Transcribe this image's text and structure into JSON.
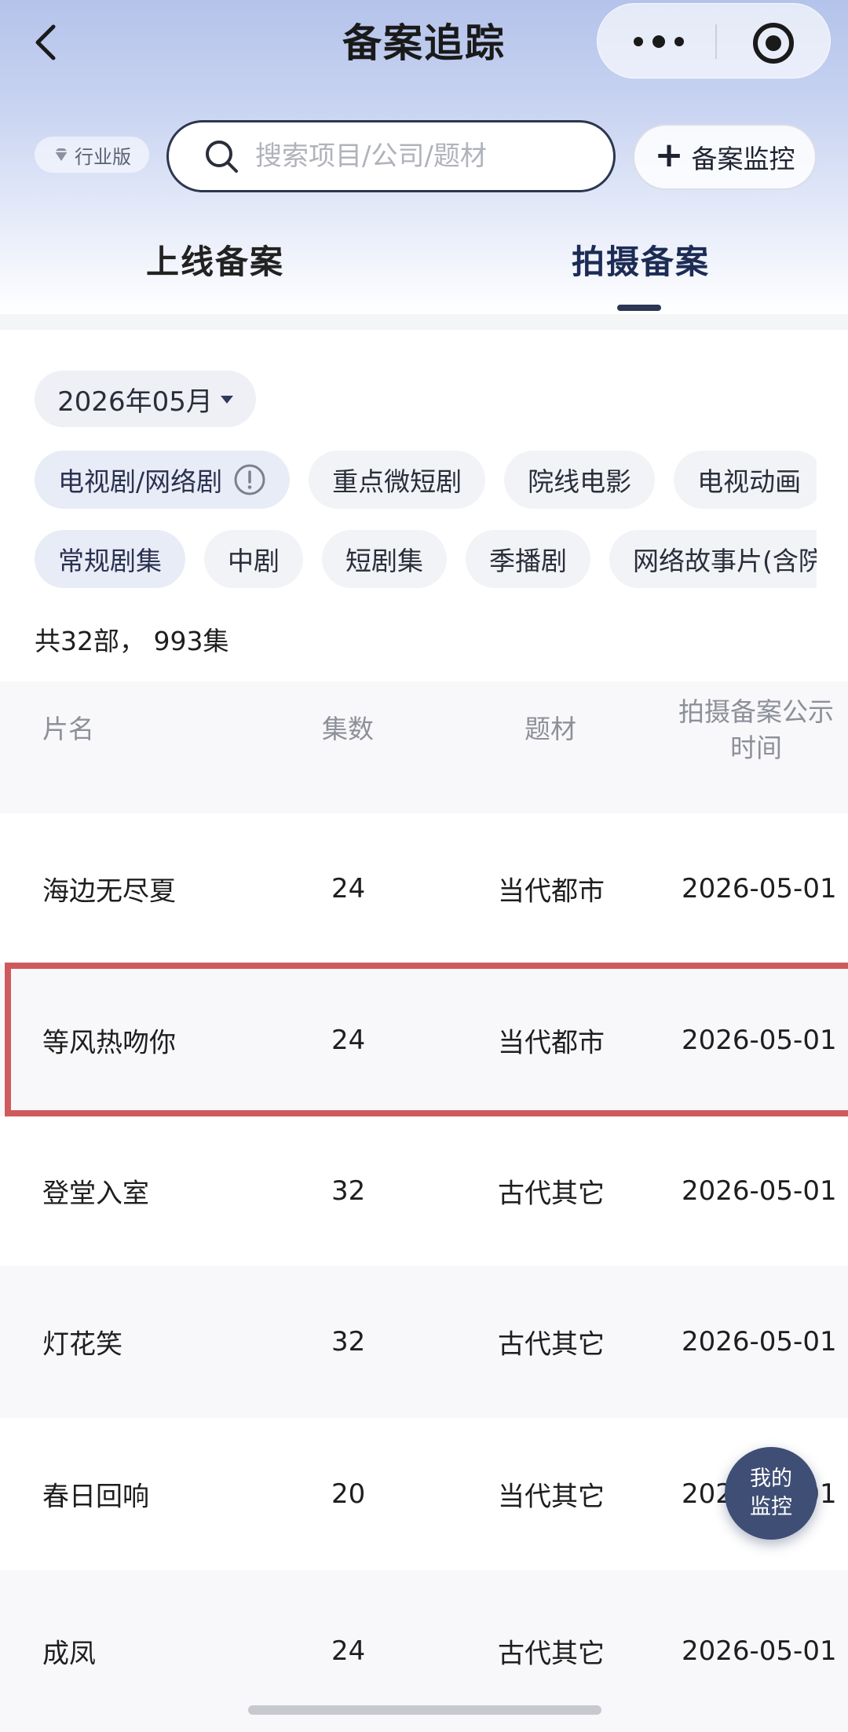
{
  "nav": {
    "title": "备案追踪",
    "back_icon": "chevron-left-icon",
    "more_icon": "more-dots-icon",
    "close_icon": "target-circle-icon"
  },
  "search": {
    "edition_badge": "行业版",
    "placeholder": "搜索项目/公司/题材",
    "value": "",
    "monitor_button": "备案监控",
    "monitor_button_icon": "plus-icon"
  },
  "tabs": {
    "online": "上线备案",
    "shooting": "拍摄备案",
    "active": "shooting"
  },
  "filters": {
    "month": "2026年05月",
    "row1": [
      "电视剧/网络剧",
      "重点微短剧",
      "院线电影",
      "电视动画"
    ],
    "row2": [
      "常规剧集",
      "中剧",
      "短剧集",
      "季播剧",
      "网络故事片(含院"
    ]
  },
  "summary": "共32部， 993集",
  "table": {
    "headers": {
      "name": "片名",
      "episodes": "集数",
      "genre": "题材",
      "date_line1": "拍摄备案公示",
      "date_line2": "时间"
    },
    "rows": [
      {
        "name": "海边无尽夏",
        "episodes": "24",
        "genre": "当代都市",
        "date": "2026-05-01"
      },
      {
        "name": "等风热吻你",
        "episodes": "24",
        "genre": "当代都市",
        "date": "2026-05-01"
      },
      {
        "name": "登堂入室",
        "episodes": "32",
        "genre": "古代其它",
        "date": "2026-05-01"
      },
      {
        "name": "灯花笑",
        "episodes": "32",
        "genre": "古代其它",
        "date": "2026-05-01"
      },
      {
        "name": "春日回响",
        "episodes": "20",
        "genre": "当代其它",
        "date": "2026-05-01"
      },
      {
        "name": "成凤",
        "episodes": "24",
        "genre": "古代其它",
        "date": "2026-05-01"
      }
    ]
  },
  "fab": {
    "line1": "我的",
    "line2": "监控"
  },
  "colors": {
    "accent": "#2b3554",
    "highlight_border": "#cf5a5d",
    "fab_bg": "#3f4e75"
  }
}
